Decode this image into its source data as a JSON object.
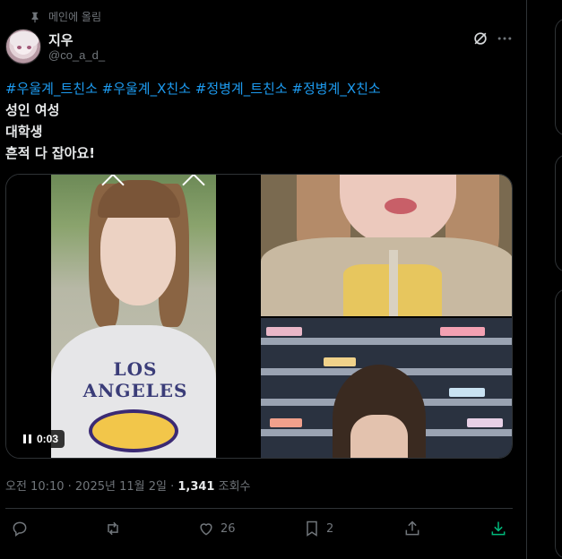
{
  "pinned_label": "메인에 올림",
  "author": {
    "name": "지우",
    "handle": "@co_a_d_"
  },
  "post": {
    "hashtags": "#우울계_트친소 #우울계_X친소 #정병계_트친소 #정병계_X친소",
    "lines": [
      "성인 여성",
      "대학생",
      "흔적 다 잡아요!"
    ]
  },
  "media": {
    "video_duration": "0:03"
  },
  "meta": {
    "time_date": "오전 10:10 · 2025년 11월 2일 · ",
    "views_count": "1,341",
    "views_label": " 조회수"
  },
  "actions": {
    "reply_count": "",
    "repost_count": "",
    "like_count": "26",
    "bookmark_count": "2"
  },
  "colors": {
    "accent": "#1d9bf0",
    "secondary_text": "#71767b",
    "border": "#2f3336",
    "background": "#000000"
  }
}
